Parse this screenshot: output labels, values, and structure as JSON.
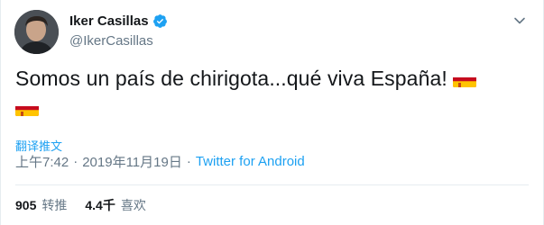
{
  "author": {
    "display_name": "Iker Casillas",
    "handle": "@IkerCasillas",
    "verified": true
  },
  "tweet": {
    "text": "Somos un país de chirigota...qué viva España!",
    "emojis": [
      "spain-flag",
      "spain-flag"
    ]
  },
  "translate_label": "翻译推文",
  "meta": {
    "time": "上午7:42",
    "date": "2019年11月19日",
    "separator": "·",
    "source": "Twitter for Android"
  },
  "stats": [
    {
      "value": "905",
      "label": "转推"
    },
    {
      "value": "4.4千",
      "label": "喜欢"
    }
  ],
  "colors": {
    "link": "#1da1f2",
    "secondary_text": "#657786",
    "primary_text": "#14171a",
    "flag_red": "#c60b1e",
    "flag_yellow": "#ffc400"
  }
}
